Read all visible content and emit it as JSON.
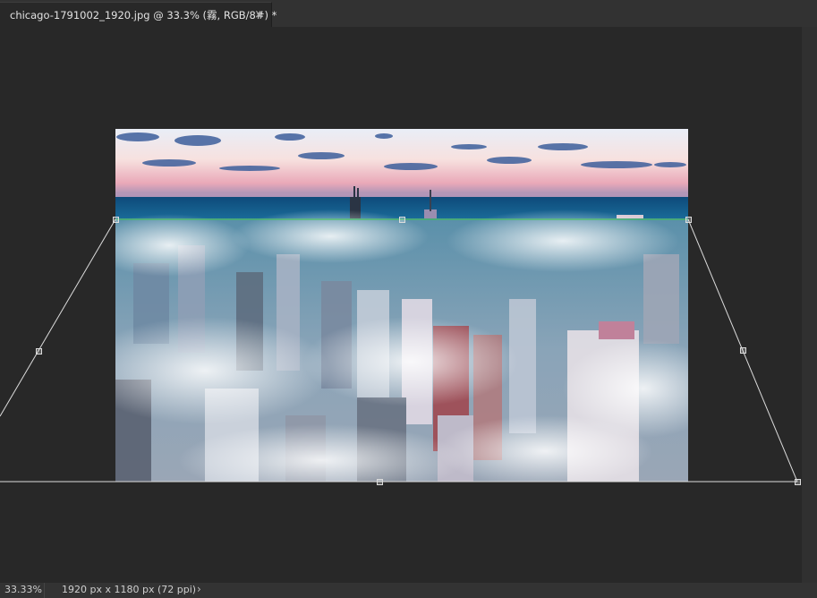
{
  "tab": {
    "title": "chicago-1791002_1920.jpg @ 33.3% (霧, RGB/8#) *",
    "close": "×"
  },
  "status": {
    "zoom": "33.33%",
    "doc_info": "1920 px x 1180 px (72 ppi)",
    "arrow": "›"
  },
  "colors": {
    "canvas_bg": "#282828",
    "transform_line": "#dcdcdc",
    "horizon_guide": "#39c24a"
  },
  "icons": {
    "close": "close-icon",
    "status_menu": "chevron-right-icon"
  }
}
